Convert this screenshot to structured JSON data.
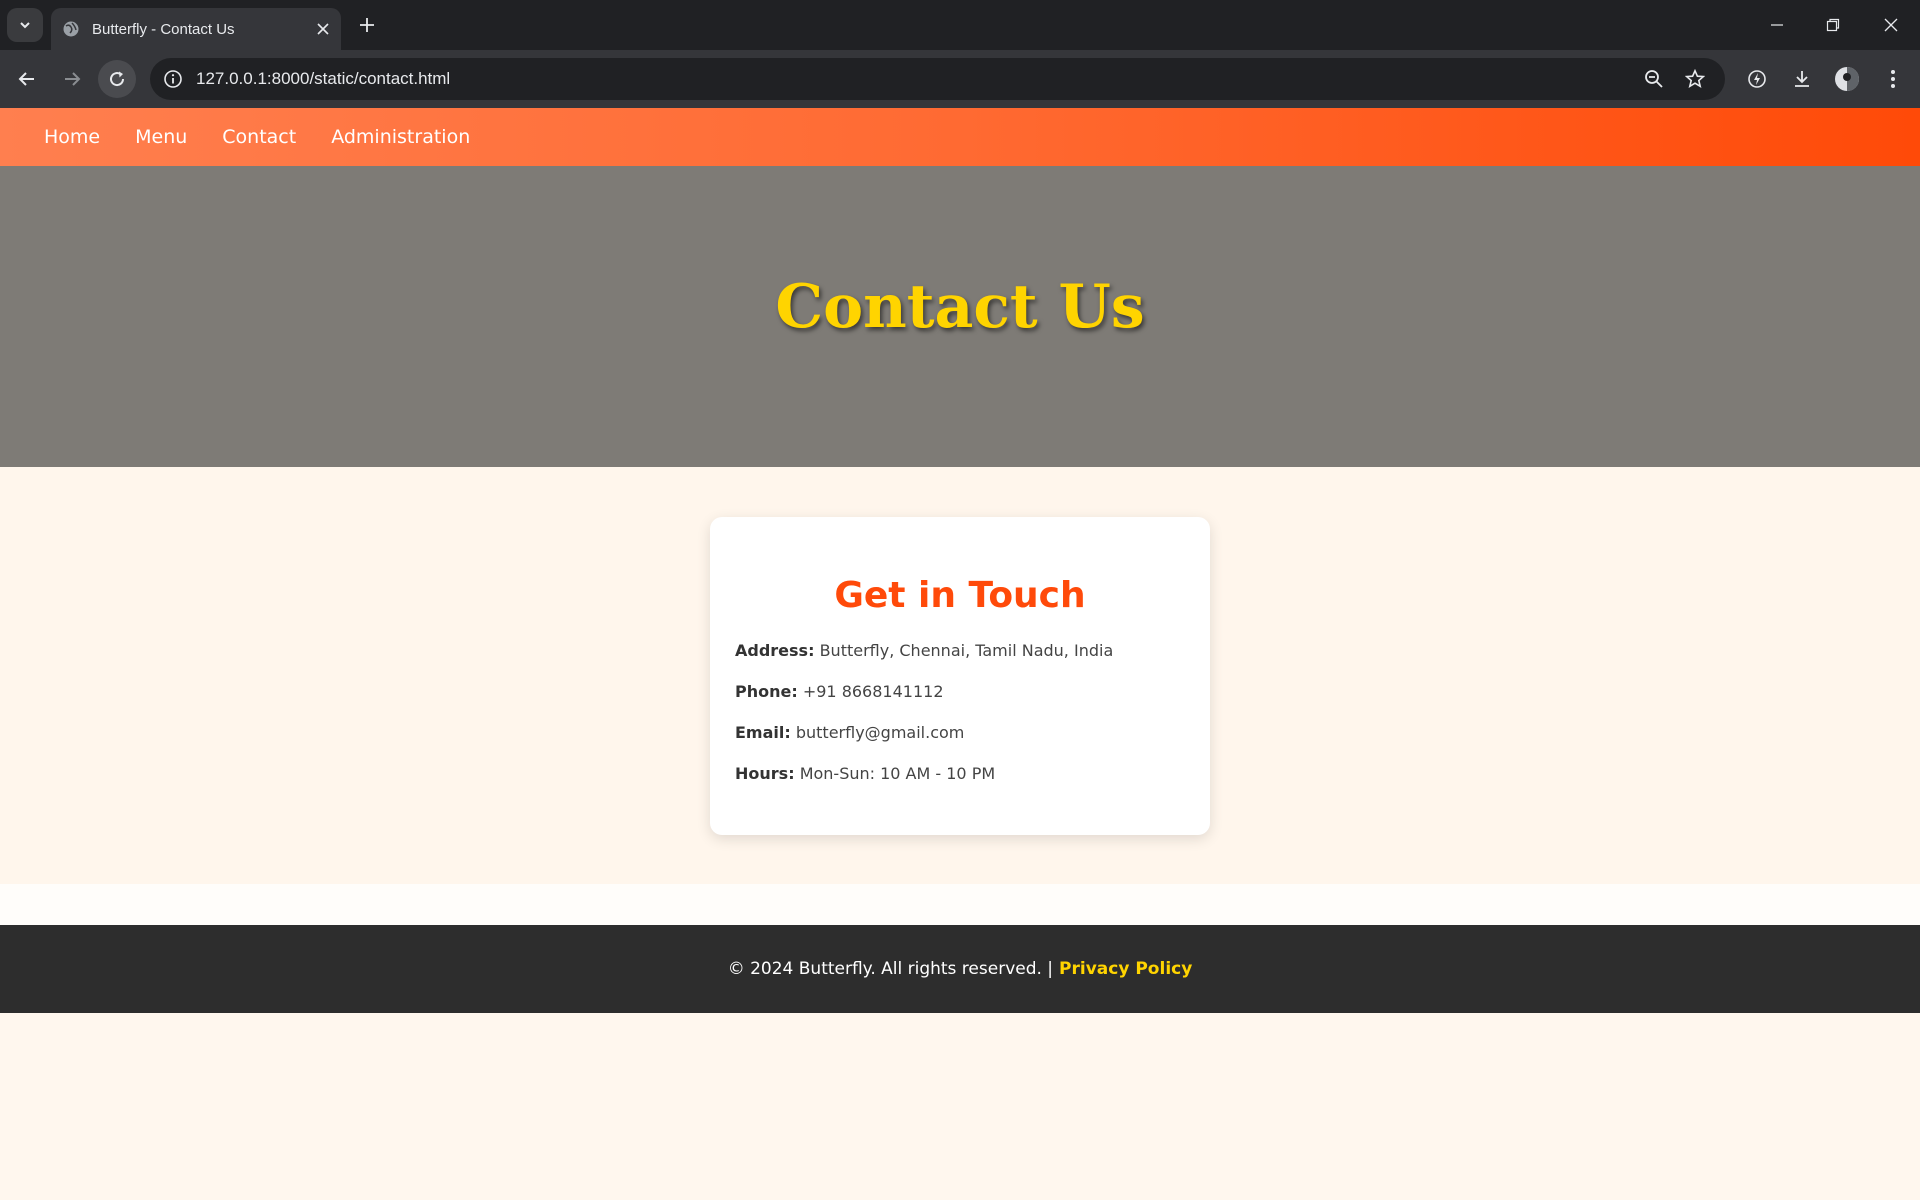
{
  "browser": {
    "tab": {
      "title": "Butterfly - Contact Us"
    },
    "address_bar": {
      "url": "127.0.0.1:8000/static/contact.html"
    },
    "icons": [
      "tab-list-icon",
      "globe-icon",
      "close-icon",
      "plus-icon",
      "minimize-icon",
      "restore-icon",
      "window-close-icon",
      "back-icon",
      "forward-icon",
      "reload-icon",
      "info-icon",
      "zoom-icon",
      "star-icon",
      "performance-icon",
      "download-icon",
      "profile-avatar",
      "more-menu-icon"
    ]
  },
  "nav": {
    "items": [
      "Home",
      "Menu",
      "Contact",
      "Administration"
    ]
  },
  "hero": {
    "title": "Contact Us"
  },
  "contact": {
    "heading": "Get in Touch",
    "rows": [
      {
        "label": "Address:",
        "value": "Butterfly, Chennai, Tamil Nadu, India"
      },
      {
        "label": "Phone:",
        "value": "+91 8668141112"
      },
      {
        "label": "Email:",
        "value": "butterfly@gmail.com"
      },
      {
        "label": "Hours:",
        "value": "Mon-Sun: 10 AM - 10 PM"
      }
    ]
  },
  "footer": {
    "text": "© 2024 Butterfly. All rights reserved. |",
    "link": "Privacy Policy"
  },
  "colors": {
    "nav_gradient_start": "#ff7f4f",
    "nav_gradient_end": "#ff4a08",
    "hero_bg": "#7e7b76",
    "hero_title": "#ffd400",
    "card_heading": "#ff4a0a",
    "footer_bg": "#2d2d2d",
    "footer_link": "#ffd400"
  }
}
